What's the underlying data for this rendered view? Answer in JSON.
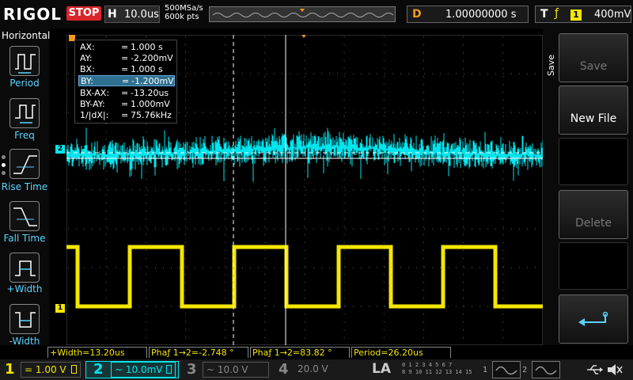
{
  "topbar": {
    "brand": "RIGOL",
    "run_state": "STOP",
    "horizontal_label": "H",
    "timebase": "10.0us",
    "sample_rate": "500MSa/s",
    "memory_depth": "600k pts",
    "delay_label": "D",
    "delay_value": "1.00000000 s",
    "trigger_label": "T",
    "trigger_edge_icon": "rising-falling-edge-icon",
    "trigger_source": "1",
    "trigger_level": "400mV"
  },
  "sidebar": {
    "title": "Horizontal",
    "items": [
      {
        "label": "Period",
        "icon": "period-measure-icon"
      },
      {
        "label": "Freq",
        "icon": "frequency-measure-icon"
      },
      {
        "label": "Rise Time",
        "icon": "rise-time-icon"
      },
      {
        "label": "Fall Time",
        "icon": "fall-time-icon"
      },
      {
        "label": "+Width",
        "icon": "positive-width-icon"
      },
      {
        "label": "-Width",
        "icon": "negative-width-icon"
      }
    ]
  },
  "cursor_panel": {
    "rows": [
      {
        "key": "AX:",
        "value": "1.000 s"
      },
      {
        "key": "AY:",
        "value": "-2.200mV"
      },
      {
        "key": "BX:",
        "value": "1.000 s"
      },
      {
        "key": "BY:",
        "value": "-1.200mV"
      },
      {
        "key": "BX-AX:",
        "value": "-13.20us"
      },
      {
        "key": "BY-AY:",
        "value": "1.000mV"
      },
      {
        "key": "1/|dX|:",
        "value": "75.76kHz"
      }
    ],
    "selected_index": 3
  },
  "markers": {
    "channel2": "2",
    "channel1": "1",
    "trigger_marker": "T"
  },
  "right_panel": {
    "menu_title": "Save",
    "buttons": [
      {
        "label": "Save",
        "enabled": false
      },
      {
        "label": "New File",
        "enabled": true
      },
      {
        "label": "",
        "enabled": false
      },
      {
        "label": "Delete",
        "enabled": false
      },
      {
        "label": "",
        "enabled": false,
        "icon": "return-arrow-icon"
      }
    ]
  },
  "measurements": [
    "+Width=13.20us",
    "Phaƒ 1→2=-2.748 °",
    "Phaƒ 1→2=83.82 °",
    "Period=26.20us"
  ],
  "bottombar": {
    "channels": [
      {
        "num": "1",
        "coupling": "=",
        "scale": "1.00 V",
        "color": "#f3e600"
      },
      {
        "num": "2",
        "coupling": "~",
        "scale": "10.0mV",
        "color": "#00e5ee"
      },
      {
        "num": "3",
        "coupling": "~",
        "scale": "10.0 V",
        "color": "#888888"
      },
      {
        "num": "4",
        "coupling": "",
        "scale": "20.0 V",
        "color": "#888888"
      }
    ],
    "la_label": "LA",
    "la_bits_top": "0 1 2 3  4 5 6 7",
    "la_bits_bottom": "8 9 10 11 12 13 14 15",
    "generators": [
      "1",
      "2"
    ],
    "usb_icon": "usb-icon",
    "speaker_icon": "speaker-muted-icon"
  },
  "colors": {
    "ch1": "#f3e600",
    "ch2": "#00e5ee",
    "accent_orange": "#f29a1c",
    "stop_red": "#d8262a"
  }
}
